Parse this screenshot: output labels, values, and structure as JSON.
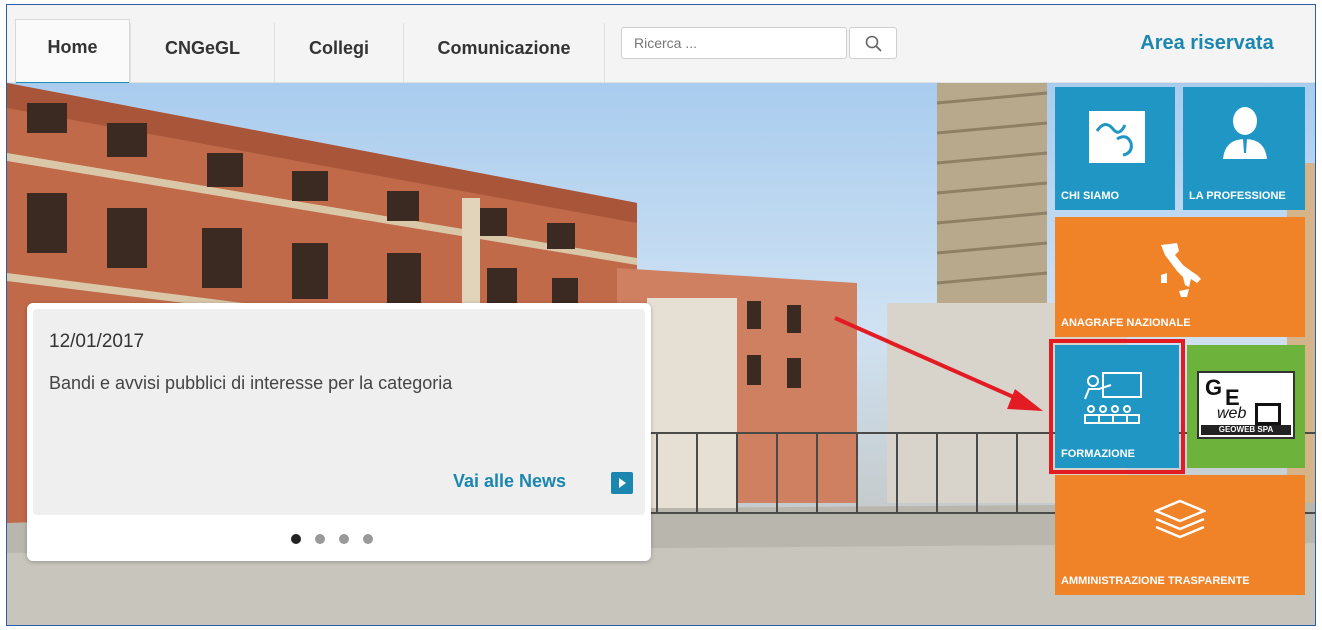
{
  "nav": {
    "tabs": [
      {
        "label": "Home",
        "active": true
      },
      {
        "label": "CNGeGL",
        "active": false
      },
      {
        "label": "Collegi",
        "active": false
      },
      {
        "label": "Comunicazione",
        "active": false
      }
    ],
    "search_placeholder": "Ricerca ...",
    "area_riservata": "Area riservata"
  },
  "news": {
    "date": "12/01/2017",
    "title": "Bandi e avvisi pubblici di interesse per la categoria",
    "link_label": "Vai alle News",
    "slides_total": 4,
    "slide_active": 1
  },
  "tiles": {
    "chi_siamo": "CHI SIAMO",
    "la_professione": "LA PROFESSIONE",
    "anagrafe": "ANAGRAFE NAZIONALE",
    "formazione": "FORMAZIONE",
    "amministrazione": "AMMINISTRAZIONE TRASPARENTE",
    "geoweb": {
      "g": "G",
      "e": "E",
      "o": "O",
      "web": "web",
      "caption": "GEOWEB SPA"
    }
  },
  "colors": {
    "accent": "#1b86b0",
    "tile_blue": "#1f96c4",
    "tile_orange": "#f08228",
    "tile_green": "#6db23b",
    "highlight": "#e31b23"
  }
}
